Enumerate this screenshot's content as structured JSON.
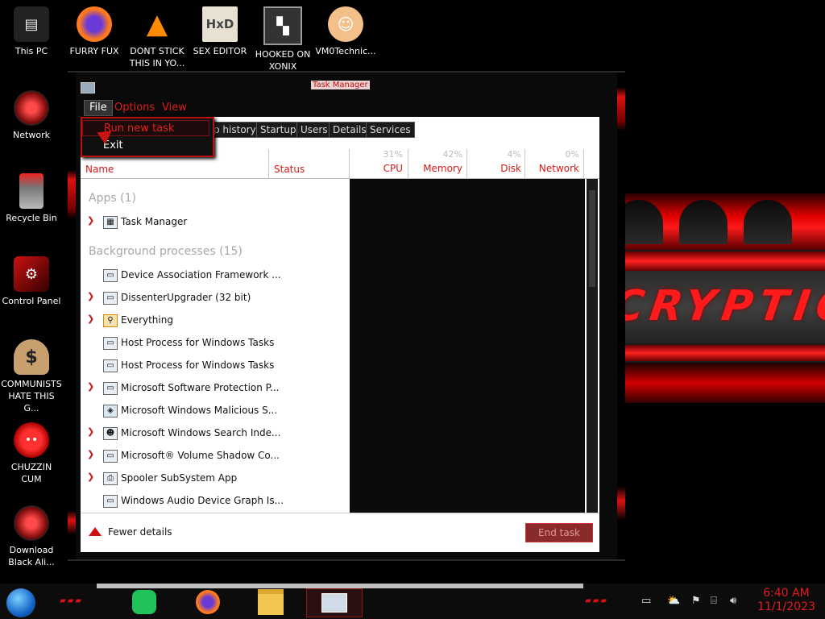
{
  "desktop": {
    "icons": [
      {
        "label": "This PC"
      },
      {
        "label": "FURRY FUX"
      },
      {
        "label": "DONT STICK THIS IN YO..."
      },
      {
        "label": "SEX EDITOR"
      },
      {
        "label": "HOOKED ON XONIX"
      },
      {
        "label": "VM0Technic..."
      },
      {
        "label": "Network"
      },
      {
        "label": "Recycle Bin"
      },
      {
        "label": "Control Panel"
      },
      {
        "label": "COMMUNISTS HATE THIS G..."
      },
      {
        "label": "CHUZZIN CUM"
      },
      {
        "label": "Download Black Ali..."
      }
    ],
    "wallpaper_text": "CRYPTIC"
  },
  "window": {
    "title": "Task Manager",
    "menu": {
      "file": "File",
      "options": "Options",
      "view": "View"
    },
    "file_menu": {
      "run_new_task": "Run new task",
      "exit": "Exit"
    },
    "tabs": [
      "p history",
      "Startup",
      "Users",
      "Details",
      "Services"
    ],
    "columns": {
      "name": "Name",
      "status": "Status",
      "cpu": {
        "label": "CPU",
        "pct": "31%"
      },
      "memory": {
        "label": "Memory",
        "pct": "42%"
      },
      "disk": {
        "label": "Disk",
        "pct": "4%"
      },
      "network": {
        "label": "Network",
        "pct": "0%"
      }
    },
    "groups": {
      "apps": "Apps (1)",
      "background": "Background processes (15)"
    },
    "apps": [
      {
        "name": "Task Manager",
        "expandable": true
      }
    ],
    "processes": [
      {
        "name": "Device Association Framework ...",
        "expandable": false
      },
      {
        "name": "DissenterUpgrader (32 bit)",
        "expandable": true
      },
      {
        "name": "Everything",
        "expandable": true
      },
      {
        "name": "Host Process for Windows Tasks",
        "expandable": false
      },
      {
        "name": "Host Process for Windows Tasks",
        "expandable": false
      },
      {
        "name": "Microsoft Software Protection P...",
        "expandable": true
      },
      {
        "name": "Microsoft Windows Malicious S...",
        "expandable": false
      },
      {
        "name": "Microsoft Windows Search Inde...",
        "expandable": true
      },
      {
        "name": "Microsoft® Volume Shadow Co...",
        "expandable": true
      },
      {
        "name": "Spooler SubSystem App",
        "expandable": true
      },
      {
        "name": "Windows Audio Device Graph Is...",
        "expandable": false
      }
    ],
    "footer": {
      "fewer_details": "Fewer details",
      "end_task": "End task"
    }
  },
  "taskbar": {
    "clock_time": "6:40 AM",
    "clock_date": "11/1/2023"
  },
  "colors": {
    "accent": "#e21c1c",
    "window_bg": "#0a0a0a"
  }
}
